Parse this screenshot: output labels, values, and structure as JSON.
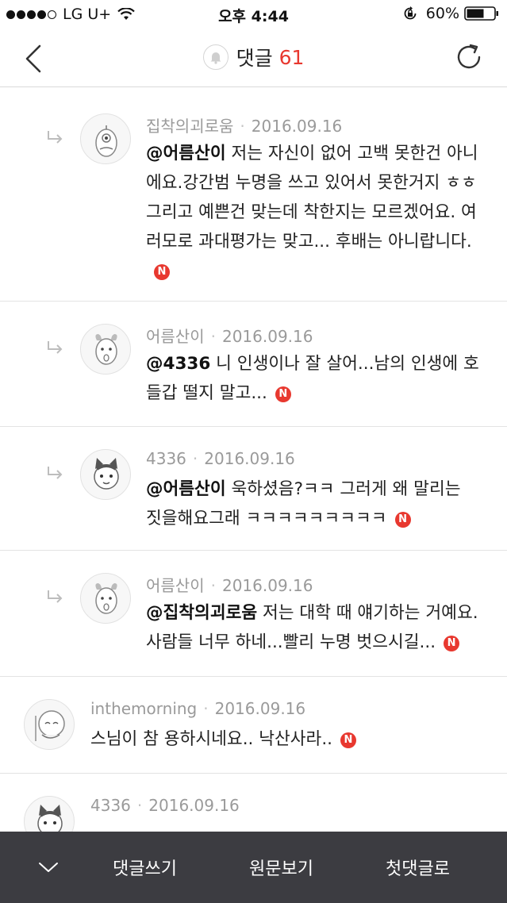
{
  "status_bar": {
    "carrier": "LG U+",
    "time": "오후 4:44",
    "battery": "60%"
  },
  "nav": {
    "title": "댓글",
    "count": "61",
    "icons": [
      "back-chevron-icon",
      "bell-icon",
      "refresh-icon"
    ]
  },
  "badge_letter": "N",
  "comments": [
    {
      "author": "집착의괴로움",
      "date": "2016.09.16",
      "mention": "@어름산이",
      "text": " 저는 자신이 없어 고백 못한건 아니에요.강간범 누명을 쓰고 있어서 못한거지 ㅎㅎ 그리고 예쁜건 맞는데 착한지는 모르겠어요. 여러모로 과대평가는 맞고... 후배는 아니랍니다.",
      "is_reply": true
    },
    {
      "author": "어름산이",
      "date": "2016.09.16",
      "mention": "@4336",
      "text": " 니 인생이나 잘 살어...남의 인생에 호들갑 떨지 말고...",
      "is_reply": true
    },
    {
      "author": "4336",
      "date": "2016.09.16",
      "mention": "@어름산이",
      "text": " 욱하셨음?ㅋㅋ 그러게 왜 말리는 짓을해요그래 ㅋㅋㅋㅋㅋㅋㅋㅋㅋ",
      "is_reply": true
    },
    {
      "author": "어름산이",
      "date": "2016.09.16",
      "mention": "@집착의괴로움",
      "text": " 저는 대학 때 얘기하는 거예요. 사람들 너무 하네...빨리 누명 벗으시길...",
      "is_reply": true
    },
    {
      "author": "inthemorning",
      "date": "2016.09.16",
      "mention": "",
      "text": "스님이 참 용하시네요.. 낙산사라..",
      "is_reply": false
    },
    {
      "author": "4336",
      "date": "2016.09.16",
      "mention": "",
      "text": "",
      "is_reply": false
    }
  ],
  "bottom_bar": {
    "write": "댓글쓰기",
    "original": "원문보기",
    "first": "첫댓글로"
  },
  "colors": {
    "accent": "#e8382f",
    "bottom_bar": "#3c3c41",
    "meta_text": "#9a9a9a"
  }
}
